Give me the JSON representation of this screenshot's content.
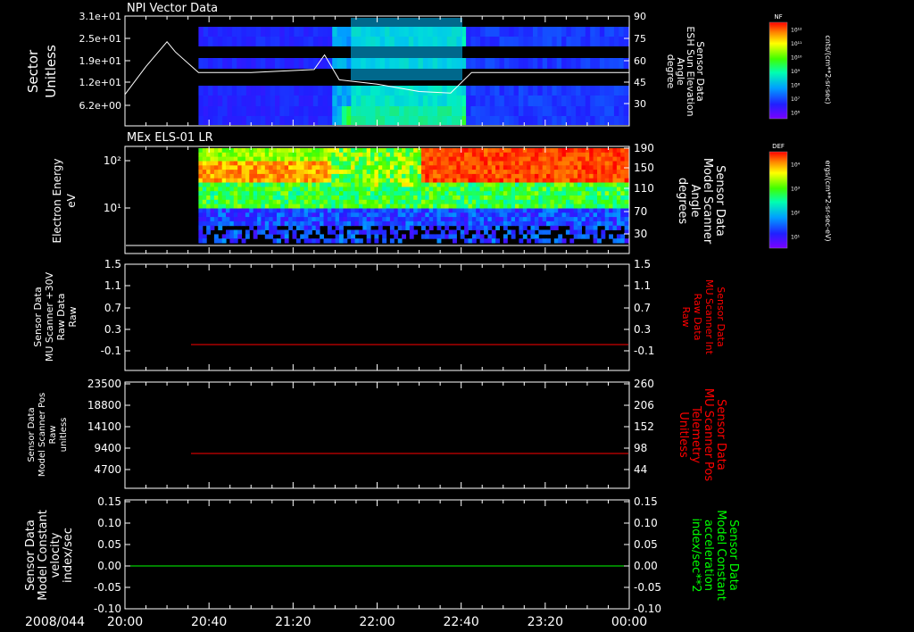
{
  "date_label": "2008/044",
  "time_ticks": [
    "20:00",
    "20:40",
    "21:20",
    "22:00",
    "22:40",
    "23:20",
    "00:00"
  ],
  "panels": [
    {
      "id": "npi",
      "title": "NPI Vector Data",
      "left_label": [
        "Sector",
        "Unitless"
      ],
      "left_ticks": [
        "3.1e+01",
        "2.5e+01",
        "1.9e+01",
        "1.2e+01",
        "6.2e+00"
      ],
      "right_label": [
        "Sensor Data",
        "ESH Sun Elevation",
        "Angle",
        "degree"
      ],
      "right_label_color": "#ffffff",
      "right_ticks": [
        "90",
        "75",
        "60",
        "45",
        "30"
      ],
      "colorbar_title": "NF",
      "colorbar_ticks": [
        "10¹²",
        "10¹¹",
        "10¹⁰",
        "10⁹",
        "10⁸",
        "10⁷",
        "10⁶"
      ],
      "colorbar_unit": "cnts/(cm**2-sr-sec)"
    },
    {
      "id": "els",
      "title": "MEx ELS-01 LR",
      "left_label": [
        "Electron Energy",
        "eV"
      ],
      "left_ticks": [
        "10²",
        "10¹"
      ],
      "right_label": [
        "Sensor Data",
        "Model Scanner",
        "Angle",
        "degrees"
      ],
      "right_label_color": "#ffffff",
      "right_ticks": [
        "190",
        "150",
        "110",
        "70",
        "30"
      ],
      "colorbar_title": "DEF",
      "colorbar_ticks": [
        "10⁴",
        "10³",
        "10²",
        "10¹"
      ],
      "colorbar_unit": "ergs/(cm**2-sr-sec-eV)"
    },
    {
      "id": "mu_raw",
      "title": "",
      "left_label": [
        "Sensor Data",
        "MU Scanner +30V",
        "Raw Data",
        "Raw"
      ],
      "left_ticks": [
        "1.5",
        "1.1",
        "0.7",
        "0.3",
        "-0.1"
      ],
      "right_label": [
        "Sensor Data",
        "MU Scanner Int",
        "Raw Data",
        "Raw"
      ],
      "right_label_color": "#ff0000",
      "right_ticks": [
        "1.5",
        "1.1",
        "0.7",
        "0.3",
        "-0.1"
      ]
    },
    {
      "id": "scanner_pos",
      "title": "",
      "left_label": [
        "Sensor Data",
        "Model Scanner Pos",
        "Raw",
        "unitless"
      ],
      "left_ticks": [
        "23500",
        "18800",
        "14100",
        "9400",
        "4700"
      ],
      "right_label": [
        "Sensor Data",
        "MU Scanner Pos",
        "Telemetry",
        "Unitless"
      ],
      "right_label_color": "#ff0000",
      "right_ticks": [
        "260",
        "206",
        "152",
        "98",
        "44"
      ]
    },
    {
      "id": "constant",
      "title": "",
      "left_label": [
        "Sensor Data",
        "Model Constant",
        "velocity",
        "index/sec"
      ],
      "left_ticks": [
        "0.15",
        "0.10",
        "0.05",
        "0.00",
        "-0.05",
        "-0.10"
      ],
      "right_label": [
        "Sensor Data",
        "Model Constant",
        "acceleration",
        "index/sec**2"
      ],
      "right_label_color": "#00ff00",
      "right_ticks": [
        "0.15",
        "0.10",
        "0.05",
        "0.00",
        "-0.05",
        "-0.10"
      ]
    }
  ],
  "chart_data": [
    {
      "type": "heatmap",
      "title": "NPI Vector Data",
      "x_range": [
        "20:00",
        "00:00"
      ],
      "ylabel": "Sector Unitless",
      "y2label": "Sensor Data ESH Sun Elevation Angle degree",
      "ylim": [
        0,
        31
      ],
      "y2lim": [
        15,
        90
      ],
      "data_start": "20:35",
      "line_series": {
        "name": "ESH Sun Elevation Angle",
        "y_axis": "right",
        "x": [
          "20:00",
          "20:10",
          "20:20",
          "20:24",
          "20:35",
          "21:00",
          "21:30",
          "21:35",
          "21:42",
          "22:00",
          "22:20",
          "22:35",
          "22:45",
          "23:00",
          "23:30",
          "00:00"
        ],
        "values": [
          45,
          64,
          81,
          74,
          60,
          60,
          62,
          72,
          55,
          52,
          47,
          46,
          60,
          60,
          60,
          60
        ]
      }
    },
    {
      "type": "heatmap",
      "title": "MEx ELS-01 LR",
      "x_range": [
        "20:00",
        "00:00"
      ],
      "ylabel": "Electron Energy eV",
      "yscale": "log",
      "y2label": "Sensor Data Model Scanner Angle degrees",
      "y2lim": [
        10,
        190
      ],
      "data_start": "20:35",
      "line_series": {
        "name": "Model Scanner Angle",
        "y_axis": "right",
        "x": [
          "20:00",
          "00:00"
        ],
        "values": [
          10,
          10
        ]
      }
    },
    {
      "type": "line",
      "x_range": [
        "20:00",
        "00:00"
      ],
      "ylim": [
        -0.3,
        1.5
      ],
      "series": [
        {
          "axis": "right",
          "color": "#ff0000",
          "x": [
            "20:35",
            "00:00"
          ],
          "values": [
            -0.05,
            -0.05
          ]
        }
      ]
    },
    {
      "type": "line",
      "x_range": [
        "20:00",
        "00:00"
      ],
      "ylim": [
        0,
        23500
      ],
      "y2lim": [
        0,
        260
      ],
      "series": [
        {
          "axis": "right",
          "color": "#ff0000",
          "x": [
            "20:35",
            "00:00"
          ],
          "values": [
            92,
            92
          ]
        }
      ]
    },
    {
      "type": "line",
      "x_range": [
        "20:00",
        "00:00"
      ],
      "ylim": [
        -0.1,
        0.15
      ],
      "series": [
        {
          "axis": "right",
          "color": "#00ff00",
          "x": [
            "20:00",
            "00:00"
          ],
          "values": [
            0.0,
            0.0
          ]
        }
      ]
    }
  ]
}
